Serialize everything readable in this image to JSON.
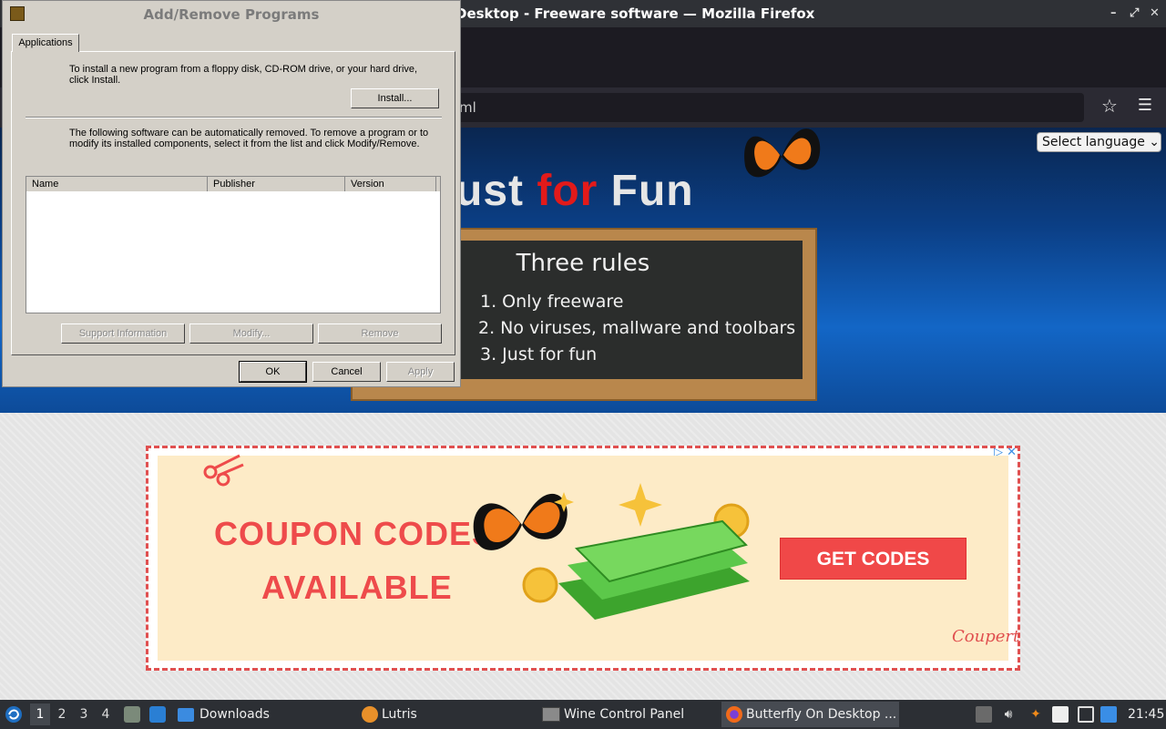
{
  "firefox": {
    "title": "Desktop - Freeware software — Mozilla Firefox",
    "url_fragment": "ml",
    "win_controls": [
      "–",
      "⤢",
      "✕"
    ]
  },
  "page": {
    "language_select": "Select language ⌄",
    "banner_title_pre": "ust ",
    "banner_title_red": "for",
    "banner_title_post": " Fun",
    "board_title": "Three rules",
    "rules": [
      "1. Only freeware",
      "2. No viruses, mallware and toolbars",
      "3. Just for fun"
    ],
    "ad": {
      "line1": "COUPON CODES",
      "line2": "AVAILABLE",
      "cta": "GET CODES",
      "logo": "Coupert",
      "adchoices": "▷ ✕"
    }
  },
  "dialog": {
    "title": "Add/Remove Programs",
    "tab": "Applications",
    "install_text": "To install a new program from a floppy disk, CD-ROM drive, or your hard drive, click Install.",
    "install_button": "Install...",
    "remove_text": "The following software can be automatically removed. To remove a program or to modify its installed components, select it from the list and click Modify/Remove.",
    "columns": [
      "Name",
      "Publisher",
      "Version"
    ],
    "support_button": "Support Information",
    "modify_button": "Modify...",
    "remove_button": "Remove",
    "ok_button": "OK",
    "cancel_button": "Cancel",
    "apply_button": "Apply"
  },
  "taskbar": {
    "workspaces": [
      "1",
      "2",
      "3",
      "4"
    ],
    "downloads": "Downloads",
    "lutris": "Lutris",
    "wine": "Wine Control Panel",
    "firefox_task": "Butterfly On Desktop ...",
    "clock": "21:45"
  },
  "colors": {
    "accent_red": "#ee4b4b",
    "firefox_chrome": "#2b2a33",
    "wine_face": "#d4d0c8"
  }
}
